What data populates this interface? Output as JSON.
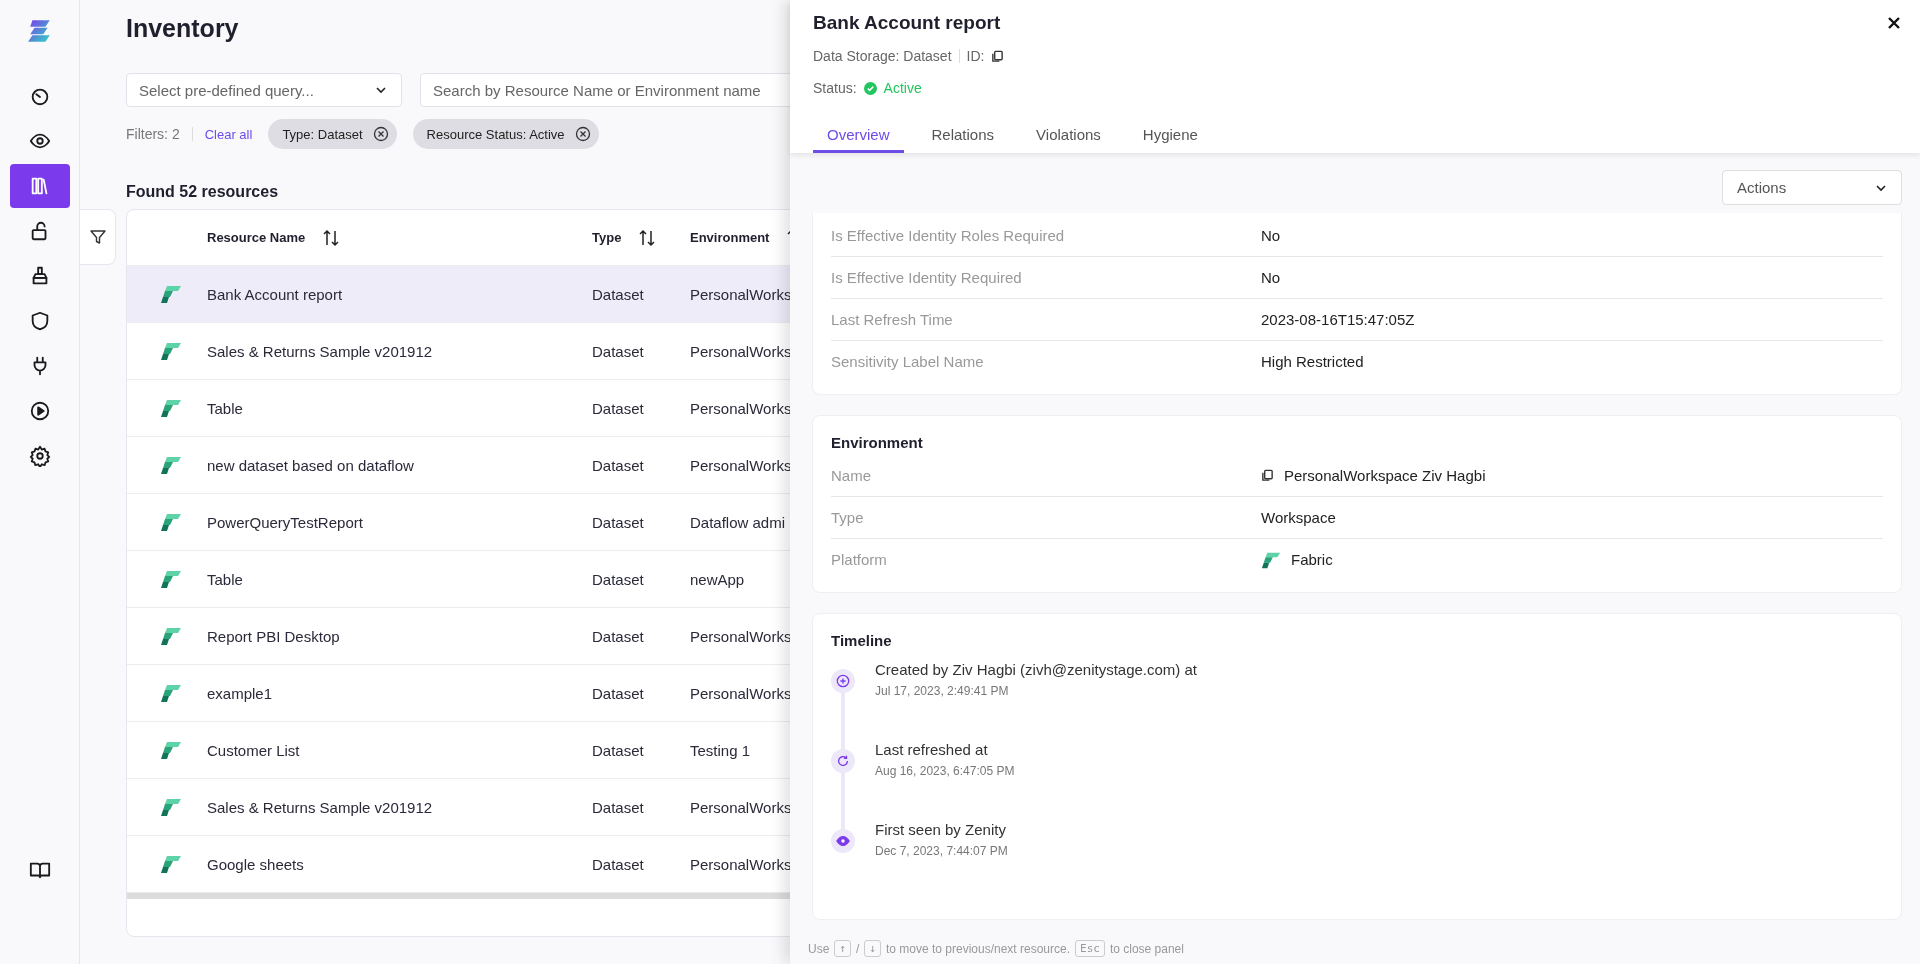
{
  "sidebar": {
    "items": [
      {
        "kind": "gauge",
        "selected": false
      },
      {
        "kind": "eye",
        "selected": false
      },
      {
        "kind": "books",
        "selected": true
      },
      {
        "kind": "unlock",
        "selected": false
      },
      {
        "kind": "broom",
        "selected": false
      },
      {
        "kind": "shield",
        "selected": false
      },
      {
        "kind": "plug",
        "selected": false
      },
      {
        "kind": "play",
        "selected": false
      },
      {
        "kind": "gear",
        "selected": false
      }
    ],
    "bottom": [
      {
        "kind": "book",
        "selected": false
      }
    ]
  },
  "page": {
    "title": "Inventory"
  },
  "query_select": {
    "placeholder": "Select pre-defined query..."
  },
  "search": {
    "placeholder": "Search by Resource Name or Environment name"
  },
  "filters": {
    "label": "Filters: 2",
    "clear": "Clear all",
    "chips": [
      "Type: Dataset",
      "Resource Status: Active"
    ]
  },
  "results": "Found 52 resources",
  "table": {
    "columns": [
      "Resource Name",
      "Type",
      "Environment"
    ],
    "rows": [
      {
        "name": "Bank Account report",
        "type": "Dataset",
        "environment": "PersonalWorks",
        "selected": true
      },
      {
        "name": "Sales & Returns Sample v201912",
        "type": "Dataset",
        "environment": "PersonalWorks",
        "selected": false
      },
      {
        "name": "Table",
        "type": "Dataset",
        "environment": "PersonalWorks",
        "selected": false
      },
      {
        "name": "new dataset based on dataflow",
        "type": "Dataset",
        "environment": "PersonalWorks",
        "selected": false
      },
      {
        "name": "PowerQueryTestReport",
        "type": "Dataset",
        "environment": "Dataflow admi",
        "selected": false
      },
      {
        "name": "Table",
        "type": "Dataset",
        "environment": "newApp",
        "selected": false
      },
      {
        "name": "Report PBI Desktop",
        "type": "Dataset",
        "environment": "PersonalWorks",
        "selected": false
      },
      {
        "name": "example1",
        "type": "Dataset",
        "environment": "PersonalWorks",
        "selected": false
      },
      {
        "name": "Customer List",
        "type": "Dataset",
        "environment": "Testing 1",
        "selected": false
      },
      {
        "name": "Sales & Returns Sample v201912",
        "type": "Dataset",
        "environment": "PersonalWorks",
        "selected": false
      },
      {
        "name": "Google sheets",
        "type": "Dataset",
        "environment": "PersonalWorks",
        "selected": false
      }
    ]
  },
  "panel": {
    "title": "Bank Account report",
    "data_storage": "Data Storage: Dataset",
    "id_label": "ID:",
    "status_label": "Status:",
    "status": {
      "text": "Active",
      "kind": "active"
    },
    "tabs": [
      {
        "label": "Overview",
        "selected": true
      },
      {
        "label": "Relations",
        "selected": false
      },
      {
        "label": "Violations",
        "selected": false
      },
      {
        "label": "Hygiene",
        "selected": false
      }
    ],
    "actions": "Actions",
    "properties": [
      {
        "label": "Is Effective Identity Roles Required",
        "value": "No"
      },
      {
        "label": "Is Effective Identity Required",
        "value": "No"
      },
      {
        "label": "Last Refresh Time",
        "value": "2023-08-16T15:47:05Z"
      },
      {
        "label": "Sensitivity Label Name",
        "value": "High Restricted"
      }
    ],
    "environment": {
      "title": "Environment",
      "rows": [
        {
          "label": "Name",
          "value": "PersonalWorkspace Ziv Hagbi",
          "kind": "copy"
        },
        {
          "label": "Type",
          "value": "Workspace",
          "kind": "plain"
        },
        {
          "label": "Platform",
          "value": "Fabric",
          "kind": "fabric"
        }
      ]
    },
    "timeline": {
      "title": "Timeline",
      "events": [
        {
          "kind": "created",
          "text": "Created by Ziv Hagbi (zivh@zenitystage.com) at",
          "time": "Jul 17, 2023, 2:49:41 PM"
        },
        {
          "kind": "refreshed",
          "text": "Last refreshed at",
          "time": "Aug 16, 2023, 6:47:05 PM"
        },
        {
          "kind": "seen",
          "text": "First seen by Zenity",
          "time": "Dec 7, 2023, 7:44:07 PM"
        }
      ]
    },
    "hint": [
      {
        "kind": "text",
        "text": "Use"
      },
      {
        "kind": "key",
        "text": "↑"
      },
      {
        "kind": "text",
        "text": "/"
      },
      {
        "kind": "key",
        "text": "↓"
      },
      {
        "kind": "text",
        "text": "to move to previous/next resource."
      },
      {
        "kind": "key",
        "text": "Esc"
      },
      {
        "kind": "text",
        "text": "to close panel"
      }
    ]
  }
}
